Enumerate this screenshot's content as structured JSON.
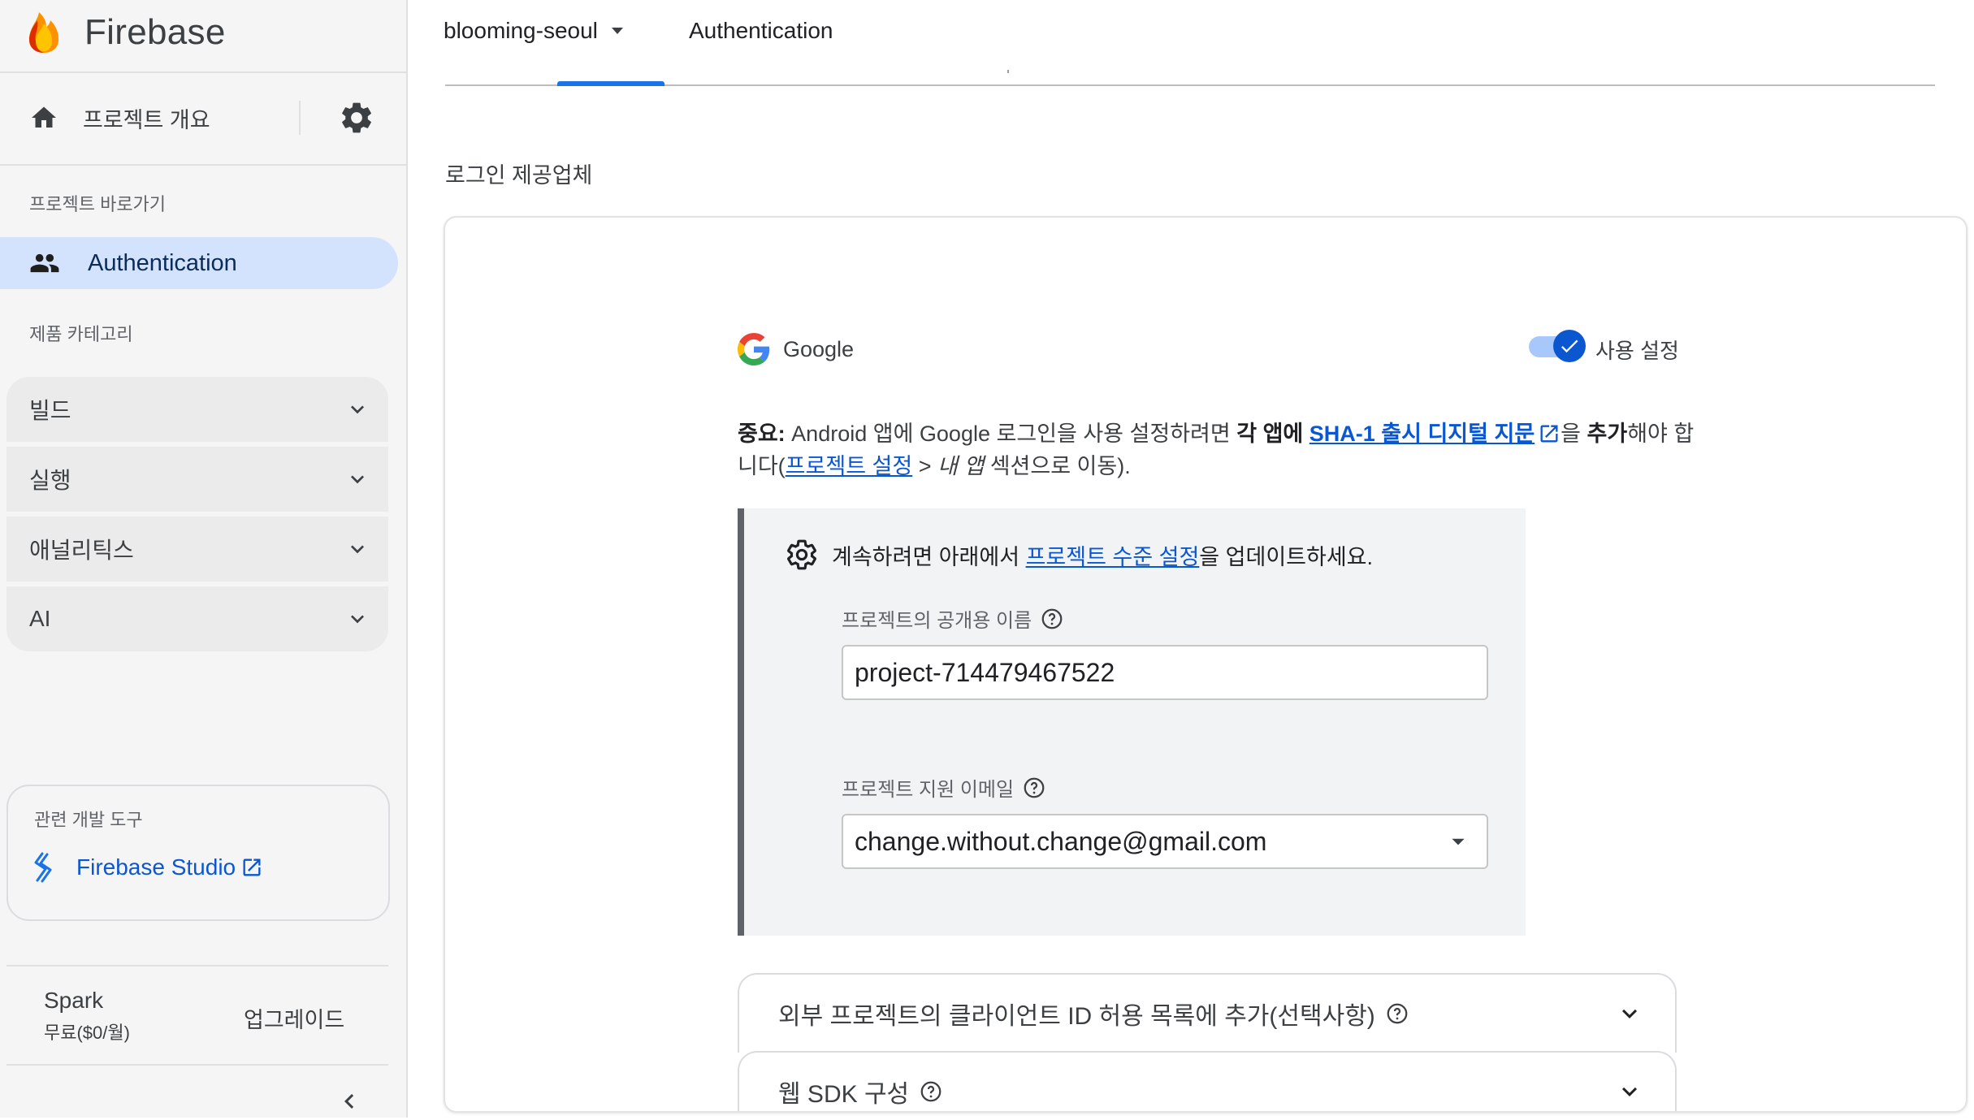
{
  "sidebar": {
    "brand": "Firebase",
    "overview_label": "프로젝트 개요",
    "shortcuts_label": "프로젝트 바로가기",
    "auth_label": "Authentication",
    "categories_label": "제품 카테고리",
    "categories": [
      {
        "label": "빌드"
      },
      {
        "label": "실행"
      },
      {
        "label": "애널리틱스"
      },
      {
        "label": "AI"
      }
    ],
    "tools_title": "관련 개발 도구",
    "studio_label": "Firebase Studio",
    "plan_name": "Spark",
    "plan_sub": "무료($0/월)",
    "upgrade_label": "업그레이드"
  },
  "header": {
    "project_name": "blooming-seoul",
    "page_title": "Authentication"
  },
  "main": {
    "section_title": "로그인 제공업체",
    "provider": {
      "name": "Google",
      "enabled": true,
      "enable_label": "사용 설정"
    },
    "important": {
      "prefix": "중요:",
      "t1": " Android 앱에 Google 로그인을 사용 설정하려면 ",
      "b1": "각 앱에 ",
      "link1": "SHA-1 출시 디지털 지문",
      "t2": "을 ",
      "b2": "추가",
      "t3": "해야 합니다(",
      "link2": "프로젝트 설정",
      "t4": " > ",
      "i1": "내 앱",
      "t5": " 섹션으로 이동)."
    },
    "settings": {
      "t1": "계속하려면 아래에서 ",
      "link": "프로젝트 수준 설정",
      "t2": "을 업데이트하세요.",
      "public_name_label": "프로젝트의 공개용 이름",
      "public_name_value": "project-714479467522",
      "support_email_label": "프로젝트 지원 이메일",
      "support_email_value": "change.without.change@gmail.com"
    },
    "accordions": [
      {
        "label": "외부 프로젝트의 클라이언트 ID 허용 목록에 추가(선택사항)"
      },
      {
        "label": "웹 SDK 구성"
      }
    ]
  },
  "colors": {
    "accent": "#0b57d0",
    "nav_active_bg": "#d3e3fd",
    "tab_indicator": "#1a73e8"
  }
}
